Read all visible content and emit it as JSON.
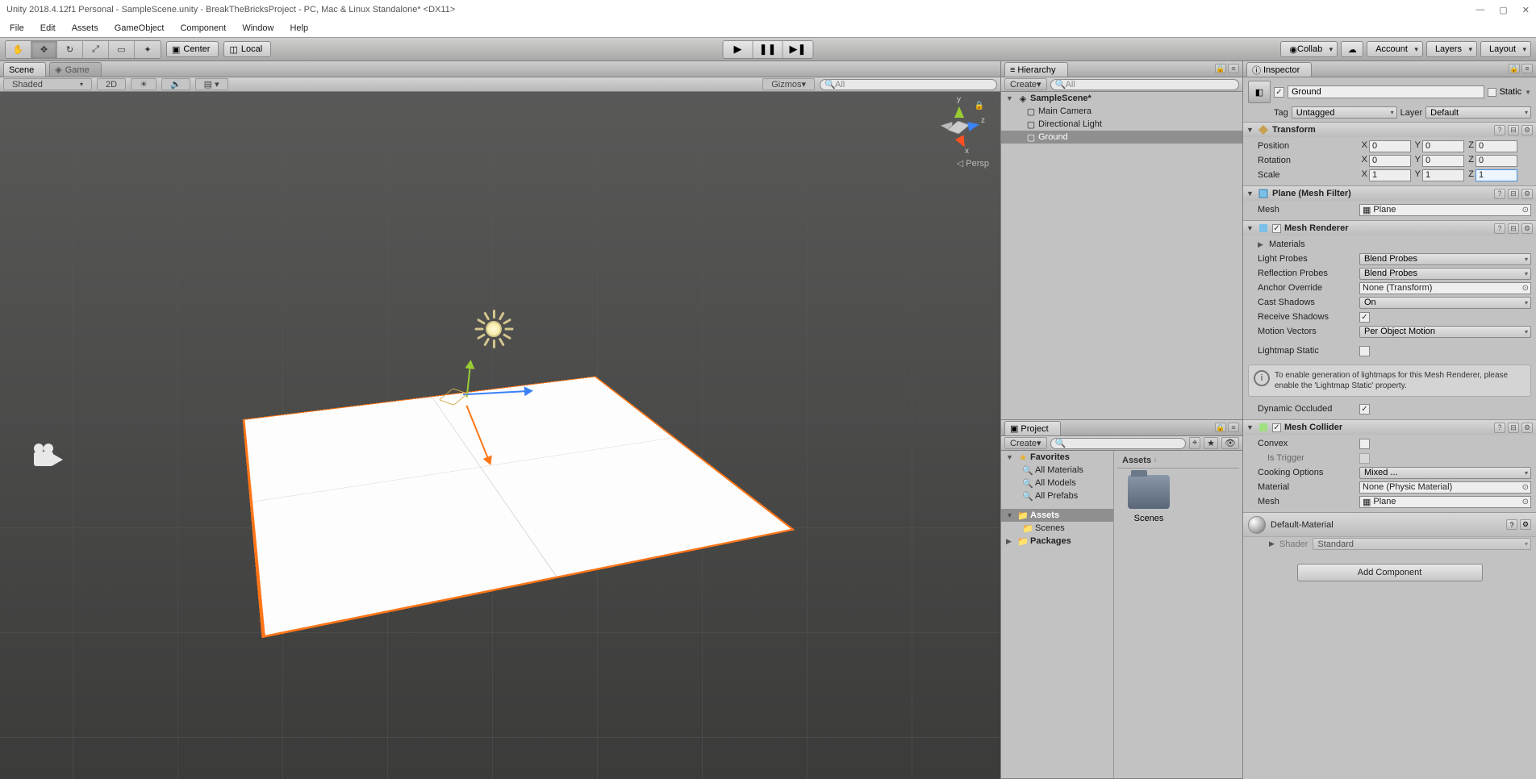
{
  "window": {
    "title": "Unity 2018.4.12f1 Personal - SampleScene.unity - BreakTheBricksProject - PC, Mac & Linux Standalone* <DX11>"
  },
  "menubar": [
    "File",
    "Edit",
    "Assets",
    "GameObject",
    "Component",
    "Window",
    "Help"
  ],
  "toolbar": {
    "pivot": "Center",
    "handle": "Local",
    "collab": "Collab",
    "account": "Account",
    "layers": "Layers",
    "layout": "Layout"
  },
  "scene": {
    "tab_scene": "Scene",
    "tab_game": "Game",
    "shaded": "Shaded",
    "twod": "2D",
    "gizmos": "Gizmos",
    "search_ph": "All",
    "persp": "Persp",
    "axis_x": "x",
    "axis_y": "y",
    "axis_z": "z"
  },
  "hierarchy": {
    "title": "Hierarchy",
    "create": "Create",
    "search_ph": "All",
    "scene_name": "SampleScene*",
    "items": [
      "Main Camera",
      "Directional Light",
      "Ground"
    ]
  },
  "project": {
    "title": "Project",
    "create": "Create",
    "favorites": "Favorites",
    "fav_items": [
      "All Materials",
      "All Models",
      "All Prefabs"
    ],
    "assets": "Assets",
    "assets_items": [
      "Scenes"
    ],
    "packages": "Packages",
    "breadcrumb": "Assets",
    "tile_scenes": "Scenes"
  },
  "inspector": {
    "title": "Inspector",
    "obj_name": "Ground",
    "static": "Static",
    "tag_label": "Tag",
    "tag_value": "Untagged",
    "layer_label": "Layer",
    "layer_value": "Default",
    "transform": {
      "title": "Transform",
      "position": "Position",
      "rotation": "Rotation",
      "scale": "Scale",
      "px": "0",
      "py": "0",
      "pz": "0",
      "rx": "0",
      "ry": "0",
      "rz": "0",
      "sx": "1",
      "sy": "1",
      "sz": "1",
      "X": "X",
      "Y": "Y",
      "Z": "Z"
    },
    "mesh_filter": {
      "title": "Plane (Mesh Filter)",
      "mesh_label": "Mesh",
      "mesh_value": "Plane"
    },
    "mesh_renderer": {
      "title": "Mesh Renderer",
      "materials": "Materials",
      "light_probes_l": "Light Probes",
      "light_probes_v": "Blend Probes",
      "refl_probes_l": "Reflection Probes",
      "refl_probes_v": "Blend Probes",
      "anchor_l": "Anchor Override",
      "anchor_v": "None (Transform)",
      "shadows_l": "Cast Shadows",
      "shadows_v": "On",
      "recv_l": "Receive Shadows",
      "motion_l": "Motion Vectors",
      "motion_v": "Per Object Motion",
      "lightmap_l": "Lightmap Static",
      "info": "To enable generation of lightmaps for this Mesh Renderer, please enable the 'Lightmap Static' property.",
      "dyn_l": "Dynamic Occluded"
    },
    "mesh_collider": {
      "title": "Mesh Collider",
      "convex": "Convex",
      "trigger": "Is Trigger",
      "cooking_l": "Cooking Options",
      "cooking_v": "Mixed ...",
      "material_l": "Material",
      "material_v": "None (Physic Material)",
      "mesh_l": "Mesh",
      "mesh_v": "Plane"
    },
    "material": {
      "name": "Default-Material",
      "shader_l": "Shader",
      "shader_v": "Standard"
    },
    "add_component": "Add Component"
  }
}
